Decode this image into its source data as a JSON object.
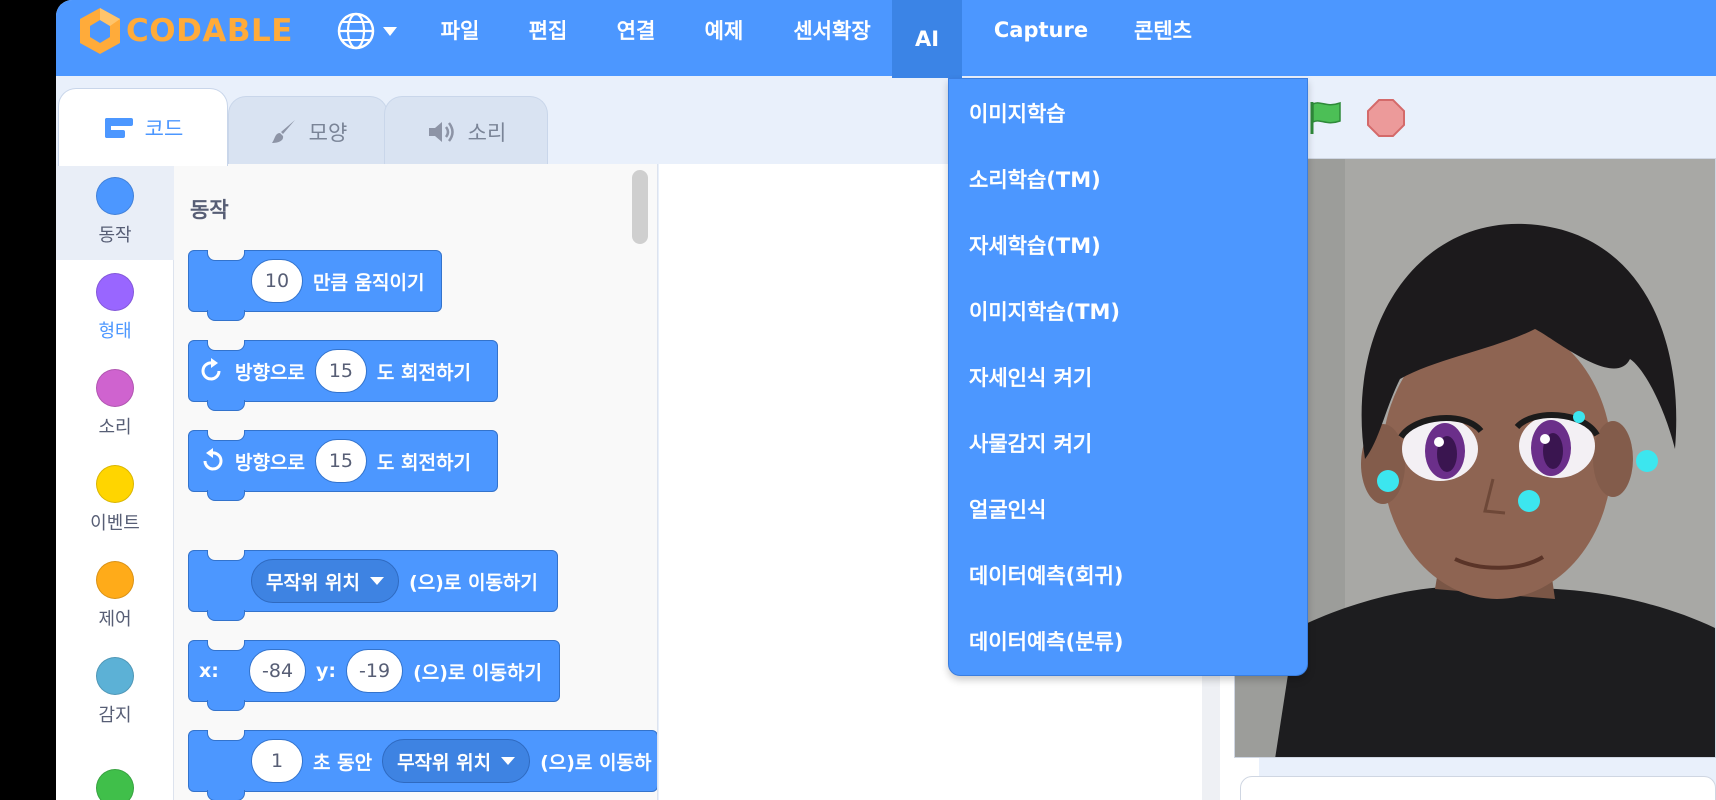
{
  "app": {
    "logo_text": "CODABLE"
  },
  "menu": {
    "items": [
      "파일",
      "편집",
      "연결",
      "예제",
      "센서확장",
      "AI",
      "Capture",
      "콘텐츠"
    ],
    "active": "AI"
  },
  "tabs": [
    {
      "label": "코드",
      "active": true
    },
    {
      "label": "모양",
      "active": false
    },
    {
      "label": "소리",
      "active": false
    }
  ],
  "categories": [
    {
      "label": "동작",
      "color": "#4c97ff",
      "active": true
    },
    {
      "label": "형태",
      "color": "#9966ff",
      "active": false
    },
    {
      "label": "소리",
      "color": "#cf63cf",
      "active": false
    },
    {
      "label": "이벤트",
      "color": "#ffd500",
      "active": false
    },
    {
      "label": "제어",
      "color": "#ffab19",
      "active": false
    },
    {
      "label": "감지",
      "color": "#5cb1d6",
      "active": false
    },
    {
      "label": "",
      "color": "#40bf4a",
      "active": false
    }
  ],
  "palette": {
    "title": "동작",
    "blocks": {
      "move": {
        "value": "10",
        "text": "만큼 움직이기"
      },
      "turn_right": {
        "prefix": "방향으로",
        "value": "15",
        "text": "도 회전하기"
      },
      "turn_left": {
        "prefix": "방향으로",
        "value": "15",
        "text": "도 회전하기"
      },
      "goto_random": {
        "dropdown": "무작위 위치",
        "text": "(으)로 이동하기"
      },
      "goto_xy": {
        "x_label": "x:",
        "x": "-84",
        "y_label": "y:",
        "y": "-19",
        "text": "(으)로 이동하기"
      },
      "glide": {
        "value": "1",
        "mid": "초 동안",
        "dropdown": "무작위 위치",
        "text": "(으)로 이동하"
      }
    }
  },
  "ai_menu": {
    "items": [
      "이미지학습",
      "소리학습(TM)",
      "자세학습(TM)",
      "이미지학습(TM)",
      "자세인식 켜기",
      "사물감지 켜기",
      "얼굴인식",
      "데이터예측(회귀)",
      "데이터예측(분류)"
    ]
  },
  "colors": {
    "menubar": "#4c97ff",
    "accent": "#4c97ff",
    "logo": "#ffab3a",
    "flag": "#4cbf56",
    "stop": "#ec5959"
  }
}
